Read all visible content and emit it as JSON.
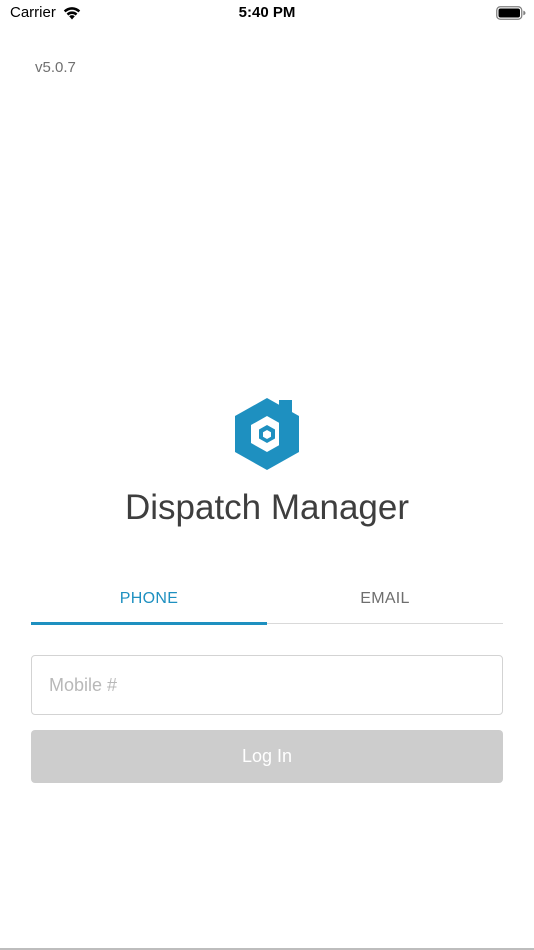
{
  "status_bar": {
    "carrier": "Carrier",
    "time": "5:40 PM",
    "wifi_icon": "wifi-icon",
    "battery_icon": "battery-icon"
  },
  "version": "v5.0.7",
  "app": {
    "name": "Dispatch Manager",
    "logo_icon": "dispatch-logo-icon",
    "brand_color": "#1e90c0"
  },
  "tabs": [
    {
      "label": "PHONE",
      "active": true
    },
    {
      "label": "EMAIL",
      "active": false
    }
  ],
  "form": {
    "mobile_placeholder": "Mobile #",
    "mobile_value": "",
    "login_label": "Log In",
    "login_enabled": false,
    "login_color": "#cdcdcd"
  }
}
